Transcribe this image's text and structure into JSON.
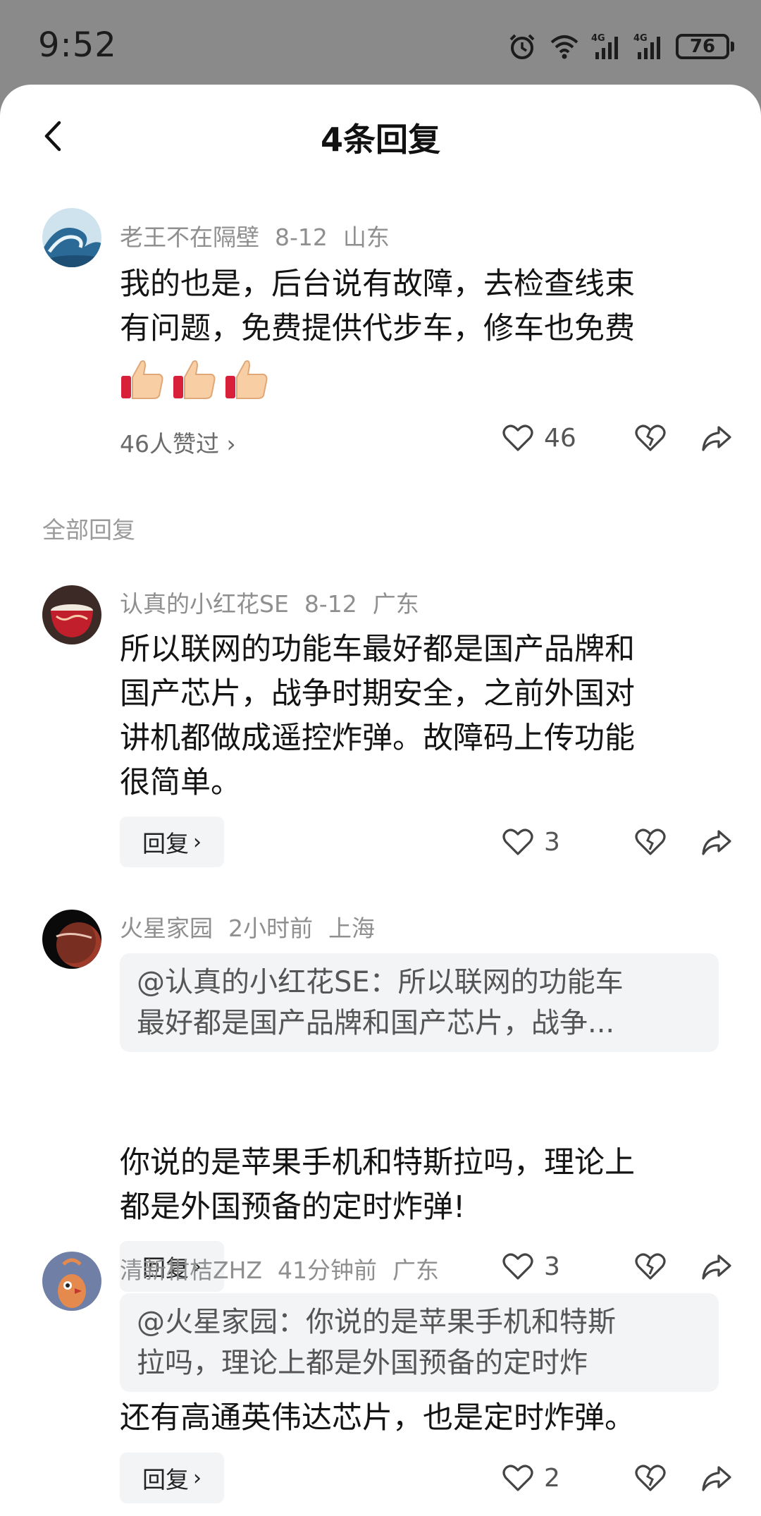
{
  "status": {
    "time": "9:52",
    "battery": "76",
    "net1": "4G",
    "net2": "4G"
  },
  "header": {
    "title": "4条回复"
  },
  "root": {
    "user": "老王不在隔壁",
    "date": "8-12",
    "location": "山东",
    "lines": [
      "我的也是，后台说有故障，去检查线束",
      "有问题，免费提供代步车，修车也免费"
    ],
    "emoji_count": 3,
    "likes_link": "46人赞过",
    "like_count": "46"
  },
  "section": {
    "label": "全部回复"
  },
  "replies": [
    {
      "user": "认真的小红花SE",
      "date": "8-12",
      "location": "广东",
      "lines": [
        "所以联网的功能车最好都是国产品牌和",
        "国产芯片，战争时期安全，之前外国对",
        "讲机都做成遥控炸弹。故障码上传功能",
        "很简单。"
      ],
      "reply_label": "回复",
      "like_count": "3"
    },
    {
      "user": "火星家园",
      "date": "2小时前",
      "location": "上海",
      "quote": [
        "@认真的小红花SE：所以联网的功能车",
        "最好都是国产品牌和国产芯片，战争..."
      ],
      "lines": [
        "你说的是苹果手机和特斯拉吗，理论上",
        "都是外国预备的定时炸弹!"
      ],
      "reply_label": "回复",
      "like_count": "3"
    },
    {
      "user": "清新柑桔ZHZ",
      "date": "41分钟前",
      "location": "广东",
      "quote": [
        "@火星家园：你说的是苹果手机和特斯",
        "拉吗，理论上都是外国预备的定时炸"
      ],
      "lines": [
        "还有高通英伟达芯片，也是定时炸弹。"
      ],
      "reply_label": "回复",
      "like_count": "2"
    }
  ],
  "icons": {
    "back": "chevron-left-icon",
    "like": "heart-outline-icon",
    "dislike": "broken-heart-icon",
    "share": "share-arrow-icon"
  },
  "colors": {
    "sheet": "#ffffff",
    "backdrop": "#8a8a8a",
    "meta": "#8f8f8f",
    "quote_bg": "#f3f4f6"
  }
}
